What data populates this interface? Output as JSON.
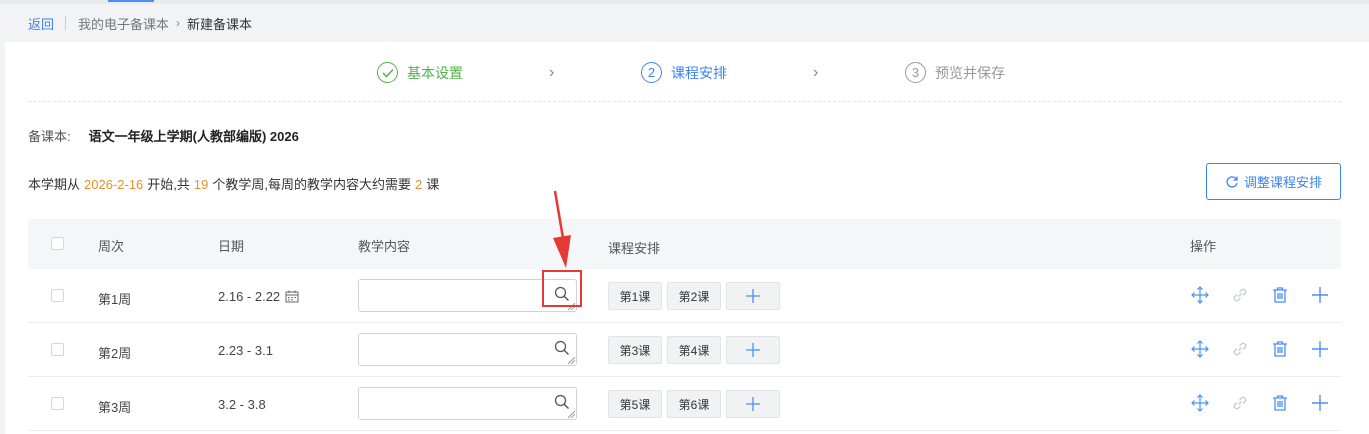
{
  "breadcrumb": {
    "back_label": "返回",
    "parent_label": "我的电子备课本",
    "current_label": "新建备课本"
  },
  "steps": [
    {
      "number": "✓",
      "label": "基本设置",
      "status": "done"
    },
    {
      "number": "2",
      "label": "课程安排",
      "status": "active"
    },
    {
      "number": "3",
      "label": "预览并保存",
      "status": "todo"
    }
  ],
  "book": {
    "label": "备课本:",
    "name": "语文一年级上学期(人教部编版) 2026"
  },
  "info": {
    "prefix": "本学期从",
    "start_date": "2026-2-16",
    "mid1": "开始,共",
    "weeks": "19",
    "mid2": "个教学周,每周的教学内容大约需要",
    "lessons_per_week": "2",
    "suffix": "课"
  },
  "adjust_button": {
    "label": "调整课程安排",
    "icon": "refresh-icon"
  },
  "table": {
    "headers": {
      "week": "周次",
      "date": "日期",
      "content": "教学内容",
      "schedule": "课程安排",
      "actions": "操作"
    },
    "rows": [
      {
        "week": "第1周",
        "date": "2.16 - 2.22",
        "show_calendar": true,
        "content": "",
        "lessons": [
          "第1课",
          "第2课"
        ]
      },
      {
        "week": "第2周",
        "date": "2.23 - 3.1",
        "show_calendar": false,
        "content": "",
        "lessons": [
          "第3课",
          "第4课"
        ]
      },
      {
        "week": "第3周",
        "date": "3.2 - 3.8",
        "show_calendar": false,
        "content": "",
        "lessons": [
          "第5课",
          "第6课"
        ]
      }
    ],
    "action_icons": [
      "move-icon",
      "link-icon",
      "delete-icon",
      "add-icon"
    ]
  },
  "colors": {
    "accent": "#3b84f5",
    "success": "#52b34a",
    "highlight_number": "#e8902b",
    "annotation": "#e53935"
  }
}
